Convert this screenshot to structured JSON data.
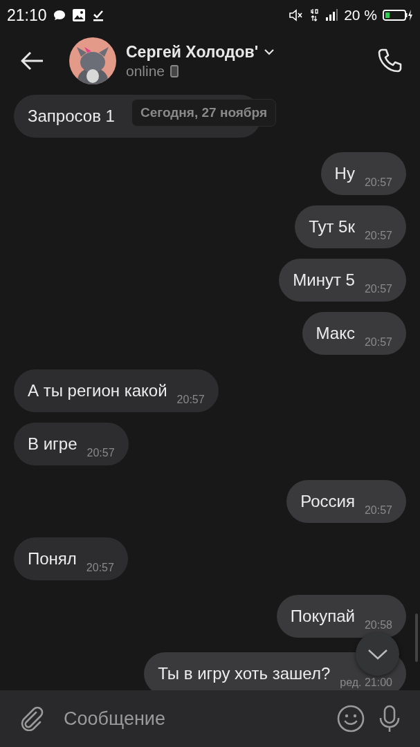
{
  "status_bar": {
    "time": "21:10",
    "battery": "20 %"
  },
  "header": {
    "name": "Сергей Холодов'",
    "presence": "online"
  },
  "date_chip": "Сегодня, 27 ноября",
  "messages": [
    {
      "outgoing": false,
      "text": "Запросов 1",
      "kind": "cut"
    },
    {
      "outgoing": true,
      "text": "Ну",
      "time": "20:57"
    },
    {
      "outgoing": true,
      "text": "Тут 5к",
      "time": "20:57"
    },
    {
      "outgoing": true,
      "text": "Минут 5",
      "time": "20:57"
    },
    {
      "outgoing": true,
      "text": "Макс",
      "time": "20:57"
    },
    {
      "outgoing": false,
      "text": "А ты регион какой",
      "time": "20:57"
    },
    {
      "outgoing": false,
      "text": "В игре",
      "time": "20:57"
    },
    {
      "outgoing": true,
      "text": "Россия",
      "time": "20:57"
    },
    {
      "outgoing": false,
      "text": "Понял",
      "time": "20:57"
    },
    {
      "outgoing": true,
      "text": "Покупай",
      "time": "20:58"
    },
    {
      "outgoing": true,
      "text": "Ты в игру хоть зашел?",
      "time": "ред. 21:00"
    }
  ],
  "composer": {
    "placeholder": "Сообщение"
  }
}
